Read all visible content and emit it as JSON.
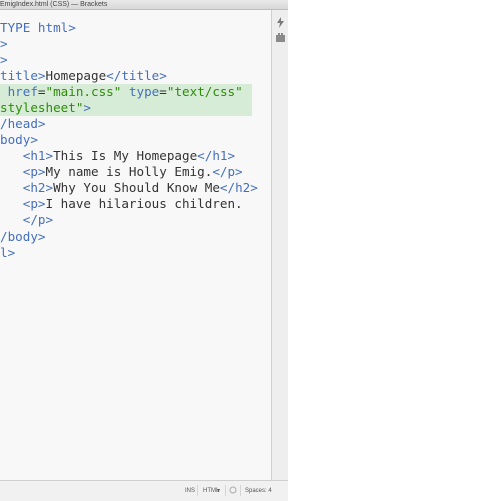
{
  "window": {
    "title": "EmigIndex.html (CSS) — Brackets"
  },
  "editor": {
    "lines": [
      {
        "parts": [
          {
            "t": "tag",
            "s": "TYPE html>"
          }
        ]
      },
      {
        "parts": [
          {
            "t": "tag",
            "s": ">"
          }
        ]
      },
      {
        "parts": [
          {
            "t": "tag",
            "s": ">"
          }
        ]
      },
      {
        "parts": [
          {
            "t": "tag",
            "s": "title>"
          },
          {
            "t": "txt",
            "s": "Homepage"
          },
          {
            "t": "tag",
            "s": "</title>"
          }
        ]
      },
      {
        "hl": true,
        "parts": [
          {
            "t": "attr",
            "s": " href"
          },
          {
            "t": "txt",
            "s": "="
          },
          {
            "t": "str",
            "s": "\"main.css\""
          },
          {
            "t": "txt",
            "s": " "
          },
          {
            "t": "attr",
            "s": "type"
          },
          {
            "t": "txt",
            "s": "="
          },
          {
            "t": "str",
            "s": "\"text/css\""
          }
        ]
      },
      {
        "hl": true,
        "parts": [
          {
            "t": "str",
            "s": "stylesheet\""
          },
          {
            "t": "tag",
            "s": ">"
          }
        ]
      },
      {
        "parts": [
          {
            "t": "tag",
            "s": "/head>"
          }
        ]
      },
      {
        "parts": [
          {
            "t": "tag",
            "s": "body>"
          }
        ]
      },
      {
        "parts": [
          {
            "t": "txt",
            "s": "   "
          },
          {
            "t": "tag",
            "s": "<h1>"
          },
          {
            "t": "txt",
            "s": "This Is My Homepage"
          },
          {
            "t": "tag",
            "s": "</h1>"
          }
        ]
      },
      {
        "parts": [
          {
            "t": "txt",
            "s": "   "
          },
          {
            "t": "tag",
            "s": "<p>"
          },
          {
            "t": "txt",
            "s": "My name is Holly Emig."
          },
          {
            "t": "tag",
            "s": "</p>"
          }
        ]
      },
      {
        "parts": [
          {
            "t": "txt",
            "s": "   "
          },
          {
            "t": "tag",
            "s": "<h2>"
          },
          {
            "t": "txt",
            "s": "Why You Should Know Me"
          },
          {
            "t": "tag",
            "s": "</h2>"
          }
        ]
      },
      {
        "parts": [
          {
            "t": "txt",
            "s": "   "
          },
          {
            "t": "tag",
            "s": "<p>"
          },
          {
            "t": "txt",
            "s": "I have hilarious children."
          }
        ]
      },
      {
        "parts": [
          {
            "t": "txt",
            "s": "   "
          },
          {
            "t": "tag",
            "s": "</p>"
          }
        ]
      },
      {
        "parts": [
          {
            "t": "tag",
            "s": "/body>"
          }
        ]
      },
      {
        "parts": [
          {
            "t": "tag",
            "s": "l>"
          }
        ]
      }
    ]
  },
  "toolbar": {
    "live_preview_icon": "live-preview-icon",
    "extension_icon": "extension-manager-icon"
  },
  "statusbar": {
    "ins_mode": "INS",
    "language": "HTML",
    "spaces_label": "Spaces: 4"
  }
}
